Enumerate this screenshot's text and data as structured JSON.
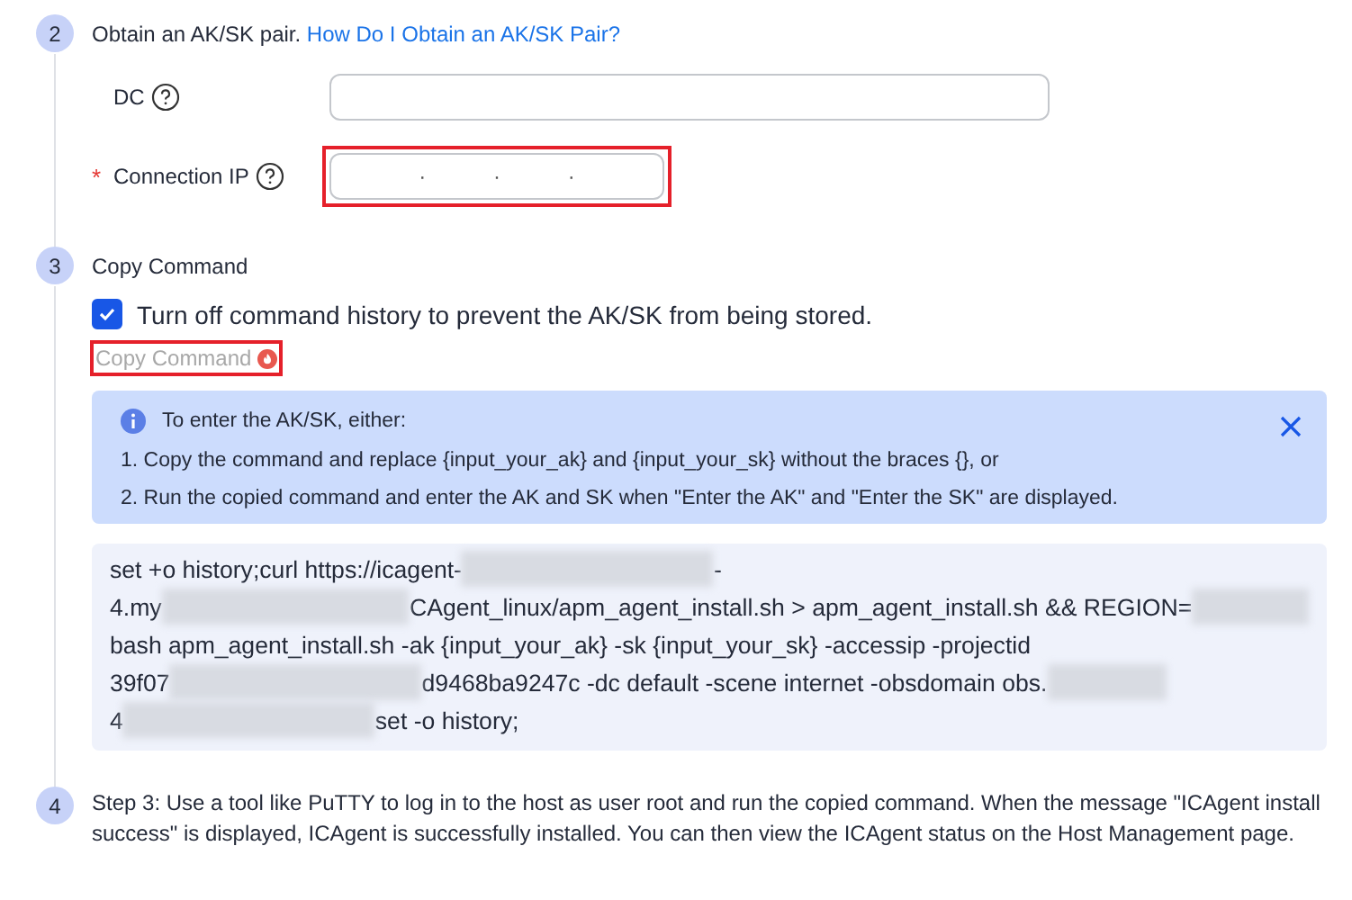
{
  "steps": [
    {
      "number": "2",
      "kind": "credentials",
      "title": "Obtain an AK/SK pair.",
      "link": "How Do I Obtain an AK/SK Pair?",
      "fields": [
        {
          "label": "DC",
          "kind": "text",
          "highlighted": false
        },
        {
          "label": "Connection IP",
          "required_mark": "*",
          "kind": "ip",
          "highlighted": true,
          "ip_dots": [
            "·",
            "·",
            "·"
          ]
        }
      ]
    },
    {
      "number": "3",
      "kind": "command",
      "title": "Copy Command",
      "checkbox": {
        "label": "Turn off command history to prevent the AK/SK from being stored.",
        "checked": true
      },
      "copy_button": {
        "label": "Copy Command",
        "disabled": true,
        "highlighted": true
      },
      "info": {
        "title": "To enter the AK/SK, either:",
        "lines": [
          "1. Copy the command and replace {input_your_ak} and {input_your_sk} without the braces {}, or",
          "2. Run the copied command and enter the AK and SK when \"Enter the AK\" and \"Enter the SK\" are displayed."
        ]
      },
      "command_lines": [
        [
          {
            "kind": "text",
            "text": "set +o history;curl https://icagent-"
          },
          {
            "kind": "redacted-long"
          },
          {
            "kind": "text",
            "text": "-"
          }
        ],
        [
          {
            "kind": "text",
            "text": "4.my"
          },
          {
            "kind": "redacted-long"
          },
          {
            "kind": "text",
            "text": "CAgent_linux/apm_agent_install.sh > apm_agent_install.sh && REGION="
          },
          {
            "kind": "redacted-short"
          }
        ],
        [
          {
            "kind": "text",
            "text": "bash apm_agent_install.sh -ak {input_your_ak} -sk {input_your_sk} -accessip -projectid"
          }
        ],
        [
          {
            "kind": "text",
            "text": "39f07"
          },
          {
            "kind": "redacted-long"
          },
          {
            "kind": "text",
            "text": "d9468ba9247c -dc default -scene internet -obsdomain obs."
          },
          {
            "kind": "redacted-short"
          }
        ],
        [
          {
            "kind": "text",
            "text": "4"
          },
          {
            "kind": "redacted-long"
          },
          {
            "kind": "text",
            "text": "set -o history;"
          }
        ]
      ]
    },
    {
      "number": "4",
      "kind": "text",
      "title": "Step 3: Use a tool like PuTTY to log in to the host as user root and run the copied command. When the message \"ICAgent install success\" is displayed, ICAgent is successfully installed. You can then view the ICAgent status on the Host Management page."
    }
  ]
}
